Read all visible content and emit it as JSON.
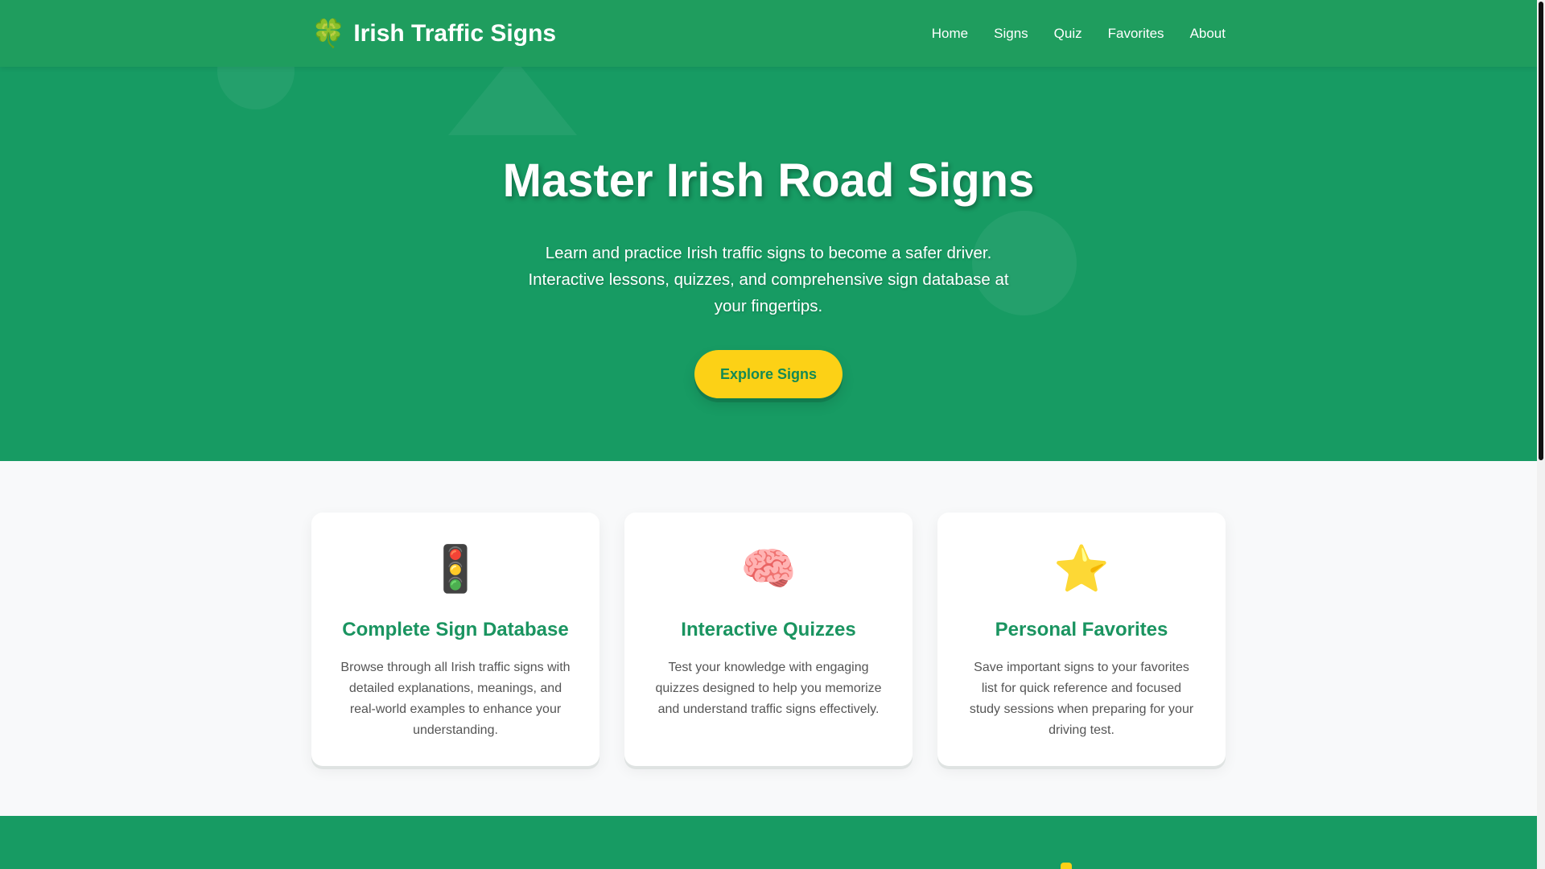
{
  "header": {
    "logo_icon": "🍀",
    "logo_text": "Irish Traffic Signs",
    "nav": [
      "Home",
      "Signs",
      "Quiz",
      "Favorites",
      "About"
    ]
  },
  "hero": {
    "title": "Master Irish Road Signs",
    "subtitle": "Learn and practice Irish traffic signs to become a safer driver. Interactive lessons, quizzes, and comprehensive sign database at your fingertips.",
    "button_label": "Explore Signs"
  },
  "features": [
    {
      "icon": "🚦",
      "title": "Complete Sign Database",
      "description": "Browse through all Irish traffic signs with detailed explanations, meanings, and real-world examples to enhance your understanding."
    },
    {
      "icon": "🧠",
      "title": "Interactive Quizzes",
      "description": "Test your knowledge with engaging quizzes designed to help you memorize and understand traffic signs effectively."
    },
    {
      "icon": "⭐",
      "title": "Personal Favorites",
      "description": "Save important signs to your favorites list for quick reference and focused study sessions when preparing for your driving test."
    }
  ],
  "colors": {
    "brand_green": "#179b63",
    "accent_yellow": "#fcd116",
    "title_green": "#1a9460"
  }
}
